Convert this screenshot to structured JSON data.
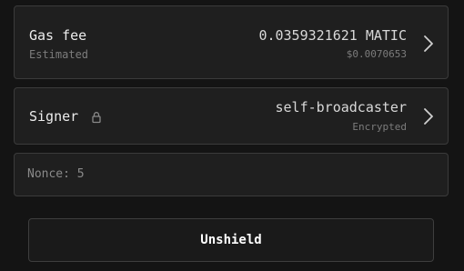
{
  "gas_fee": {
    "label": "Gas fee",
    "sublabel": "Estimated",
    "amount": "0.0359321621 MATIC",
    "usd": "$0.0070653"
  },
  "signer": {
    "label": "Signer",
    "value": "self-broadcaster",
    "sublabel": "Encrypted",
    "icon": "lock-icon"
  },
  "nonce": {
    "text": "Nonce: 5"
  },
  "actions": {
    "unshield_label": "Unshield"
  },
  "icons": {
    "row_chevron": "chevron-right-icon"
  }
}
